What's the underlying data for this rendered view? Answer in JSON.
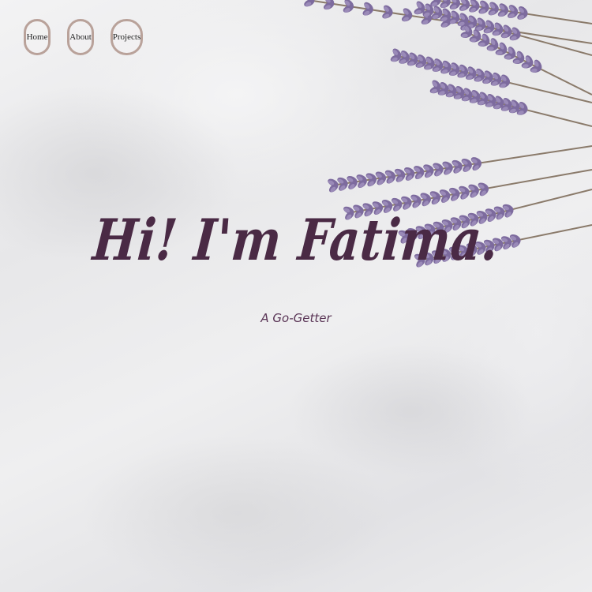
{
  "nav": {
    "items": [
      {
        "label": "Home"
      },
      {
        "label": "About"
      },
      {
        "label": "Projects"
      }
    ]
  },
  "hero": {
    "title": "Hi! I'm Fatima.",
    "subtitle": "A Go-Getter"
  },
  "colors": {
    "title": "#4a2a45",
    "nav_border": "#b9a29a",
    "lavender": "#7b6a9c"
  },
  "decoration": {
    "image": "lavender-sprigs"
  }
}
